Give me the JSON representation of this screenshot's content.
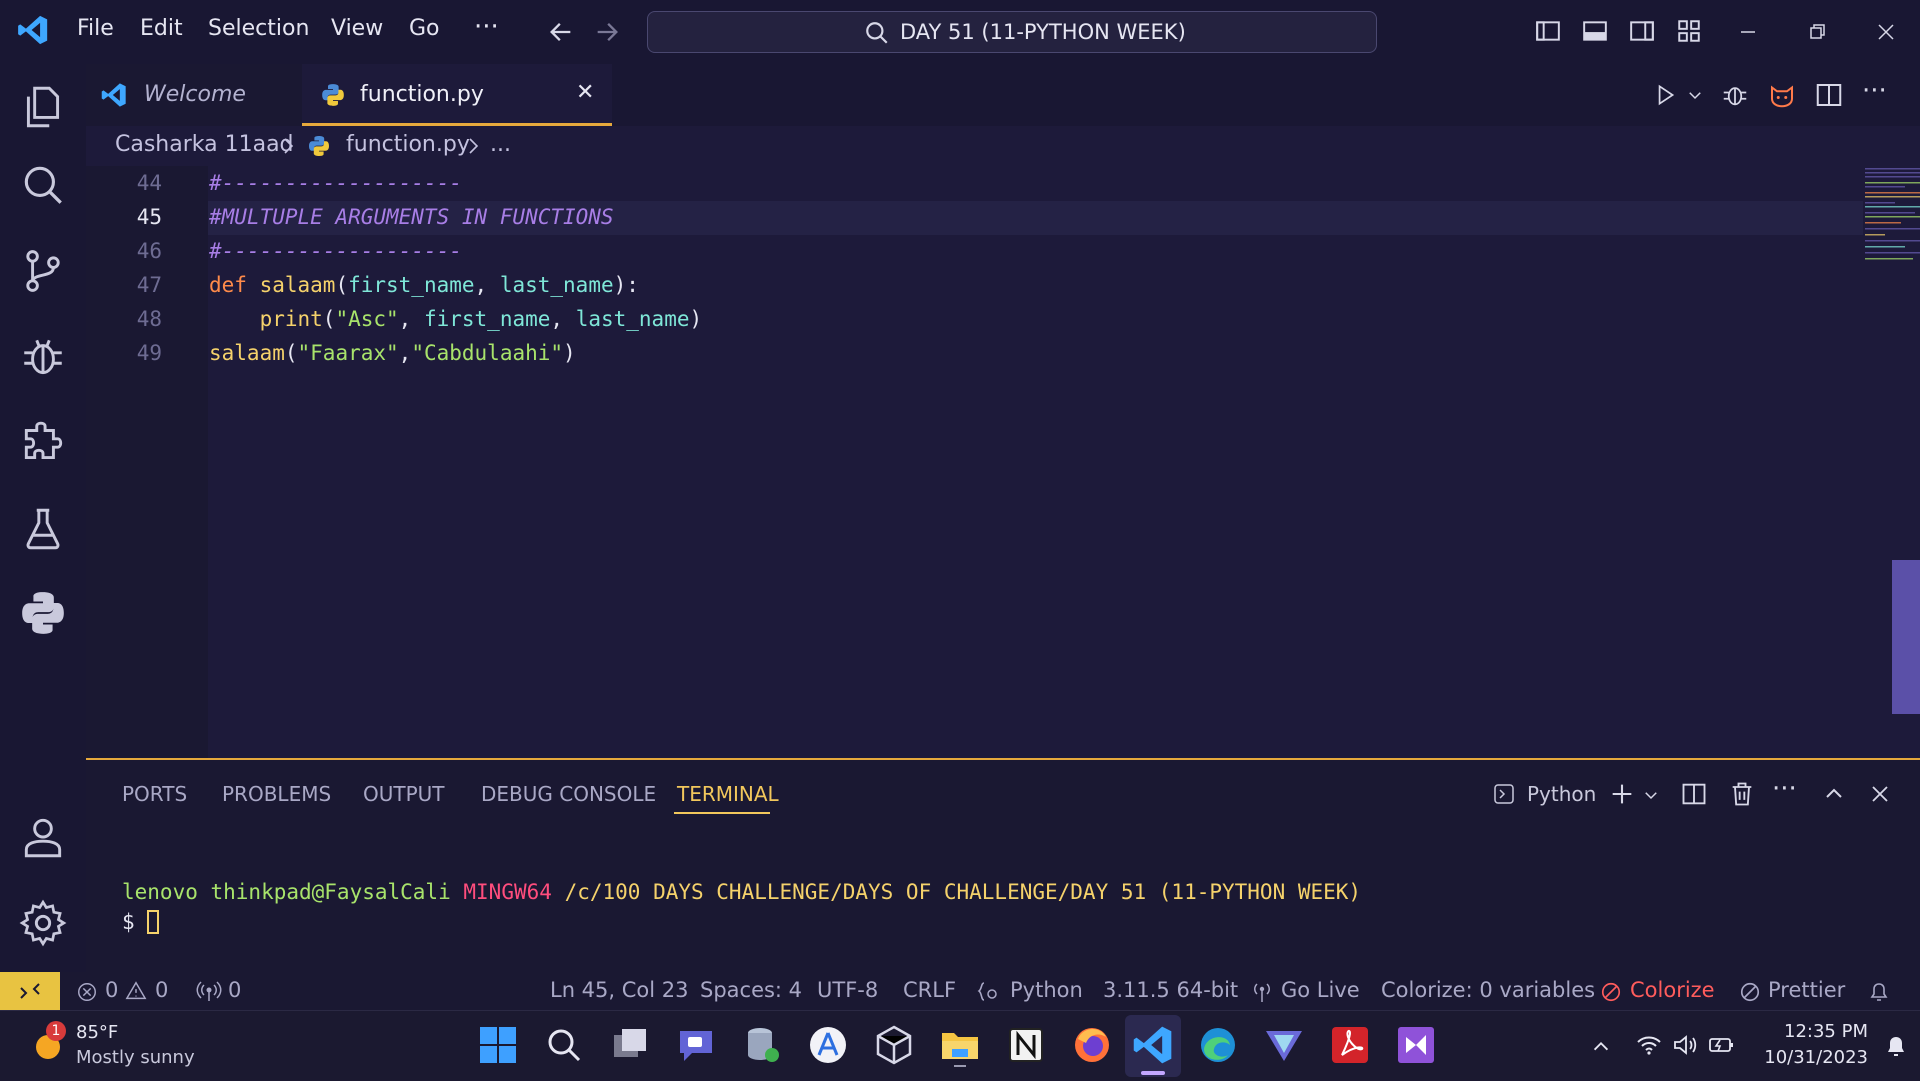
{
  "titlebar": {
    "menu": [
      "File",
      "Edit",
      "Selection",
      "View",
      "Go"
    ],
    "more": "···",
    "search_text": "DAY 51 (11-PYTHON WEEK)"
  },
  "tabs": [
    {
      "label": "Welcome"
    },
    {
      "label": "function.py",
      "close": "✕"
    }
  ],
  "breadcrumb": {
    "folder": "Casharka 11aad",
    "file": "function.py",
    "more": "..."
  },
  "editor": {
    "current_line": 45,
    "lines": [
      {
        "n": "44",
        "tokens": [
          {
            "c": "c-comment",
            "t": "#-------------------"
          }
        ]
      },
      {
        "n": "45",
        "tokens": [
          {
            "c": "c-comment",
            "t": "#MULTUPLE ARGUMENTS IN FUNCTIONS"
          }
        ]
      },
      {
        "n": "46",
        "tokens": [
          {
            "c": "c-comment",
            "t": "#-------------------"
          }
        ]
      },
      {
        "n": "47",
        "tokens": [
          {
            "c": "c-kw",
            "t": "def "
          },
          {
            "c": "c-fn",
            "t": "salaam"
          },
          {
            "c": "c-plain",
            "t": "("
          },
          {
            "c": "c-var",
            "t": "first_name"
          },
          {
            "c": "c-plain",
            "t": ", "
          },
          {
            "c": "c-var",
            "t": "last_name"
          },
          {
            "c": "c-plain",
            "t": "):"
          }
        ]
      },
      {
        "n": "48",
        "tokens": [
          {
            "c": "c-plain",
            "t": "    "
          },
          {
            "c": "c-fn",
            "t": "print"
          },
          {
            "c": "c-plain",
            "t": "("
          },
          {
            "c": "c-str",
            "t": "\"Asc\""
          },
          {
            "c": "c-plain",
            "t": ", "
          },
          {
            "c": "c-var",
            "t": "first_name"
          },
          {
            "c": "c-plain",
            "t": ", "
          },
          {
            "c": "c-var",
            "t": "last_name"
          },
          {
            "c": "c-plain",
            "t": ")"
          }
        ]
      },
      {
        "n": "49",
        "tokens": [
          {
            "c": "c-fn",
            "t": "salaam"
          },
          {
            "c": "c-plain",
            "t": "("
          },
          {
            "c": "c-str",
            "t": "\"Faarax\""
          },
          {
            "c": "c-plain",
            "t": ","
          },
          {
            "c": "c-str",
            "t": "\"Cabdulaahi\""
          },
          {
            "c": "c-plain",
            "t": ")"
          }
        ]
      }
    ]
  },
  "panel": {
    "tabs": [
      "PORTS",
      "PROBLEMS",
      "OUTPUT",
      "DEBUG CONSOLE",
      "TERMINAL"
    ],
    "active_tab": "TERMINAL",
    "terminal_profile": "Python",
    "prompt": {
      "user": "lenovo thinkpad@FaysalCali",
      "system": "MINGW64",
      "path": "/c/100 DAYS CHALLENGE/DAYS OF CHALLENGE/DAY 51 (11-PYTHON WEEK)",
      "symbol": "$"
    }
  },
  "statusbar": {
    "errors": "0",
    "warnings": "0",
    "ports": "0",
    "position": "Ln 45, Col 23",
    "spaces": "Spaces: 4",
    "encoding": "UTF-8",
    "eol": "CRLF",
    "language": "Python",
    "interpreter": "3.11.5 64-bit",
    "go_live": "Go Live",
    "colorize_vars": "Colorize: 0 variables",
    "colorize": "Colorize",
    "prettier": "Prettier"
  },
  "taskbar": {
    "weather_badge": "1",
    "temperature": "85°F",
    "condition": "Mostly sunny",
    "time": "12:35 PM",
    "date": "10/31/2023"
  },
  "colors": {
    "accent": "#e6a93c",
    "terminal_user": "#a8e36b",
    "terminal_system": "#ff4d7d",
    "terminal_path": "#f5d26b",
    "status_error": "#ff5c5c",
    "remote": "#e8c341"
  }
}
